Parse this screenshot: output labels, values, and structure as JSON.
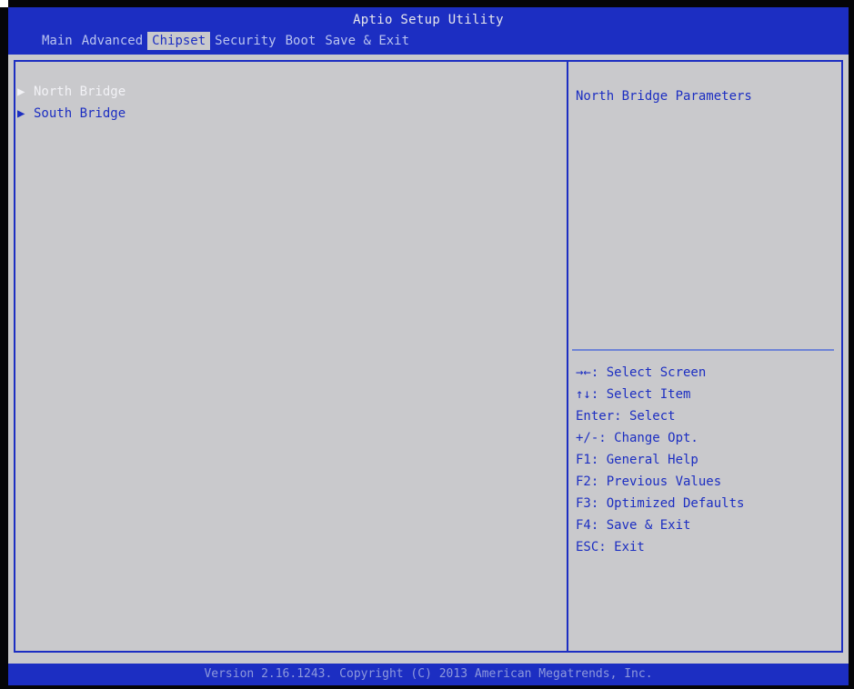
{
  "header": {
    "title": "Aptio Setup Utility",
    "tabs": [
      {
        "label": "Main",
        "active": false
      },
      {
        "label": "Advanced",
        "active": false
      },
      {
        "label": "Chipset",
        "active": true
      },
      {
        "label": "Security",
        "active": false
      },
      {
        "label": "Boot",
        "active": false
      },
      {
        "label": "Save & Exit",
        "active": false
      }
    ]
  },
  "menu": {
    "items": [
      {
        "label": "North Bridge",
        "selected": true
      },
      {
        "label": "South Bridge",
        "selected": false
      }
    ]
  },
  "help": {
    "description": "North Bridge Parameters",
    "keys": [
      "→←: Select Screen",
      "↑↓: Select Item",
      "Enter: Select",
      "+/-: Change Opt.",
      "F1: General Help",
      "F2: Previous Values",
      "F3: Optimized Defaults",
      "F4: Save & Exit",
      "ESC: Exit"
    ]
  },
  "footer": {
    "version": "Version 2.16.1243. Copyright (C) 2013 American Megatrends, Inc."
  },
  "colors": {
    "bar_blue": "#1c2ec2",
    "panel_gray": "#c9c9cc",
    "selected_text": "#f2f2f6"
  }
}
